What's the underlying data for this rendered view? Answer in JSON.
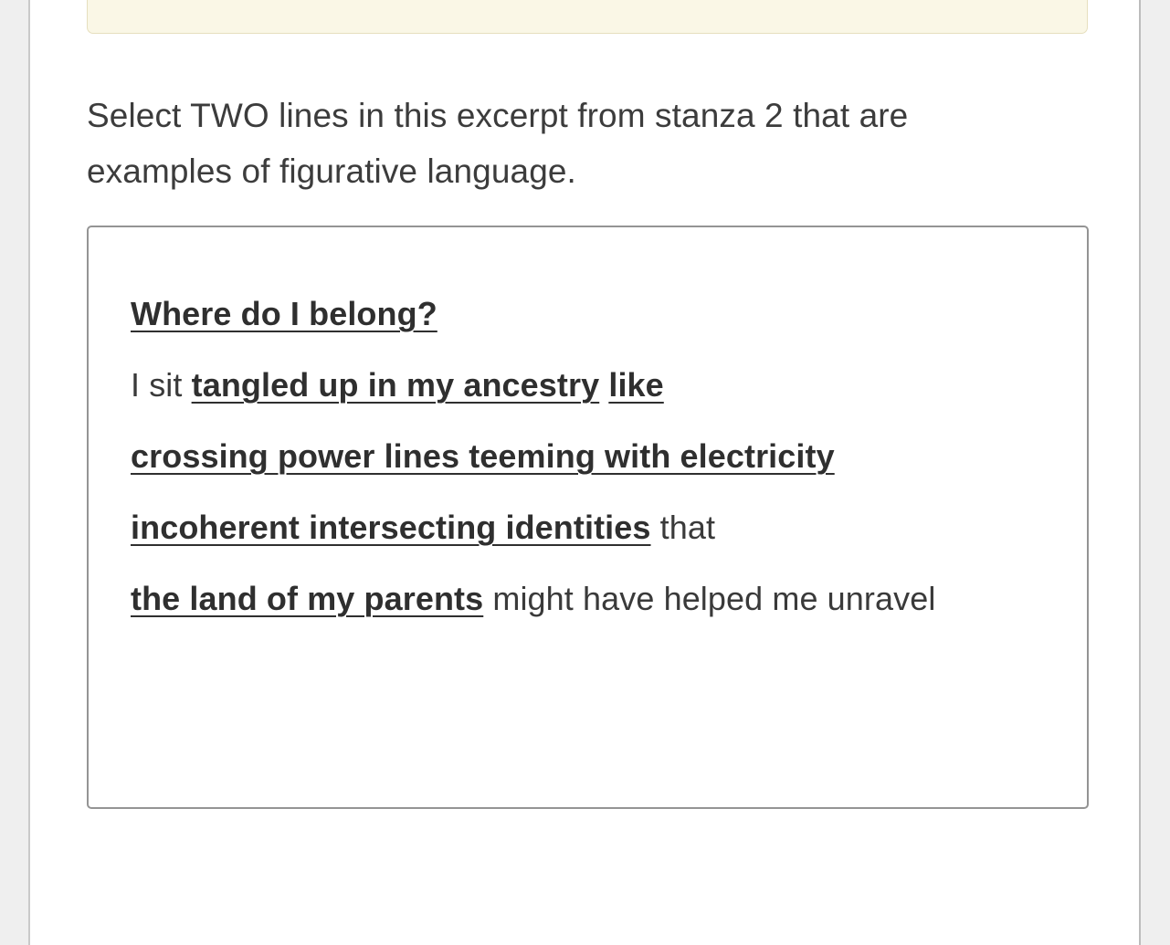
{
  "question": {
    "prompt": "Select TWO lines in this excerpt from stanza 2 that are examples of figurative language."
  },
  "excerpt": {
    "segments": [
      {
        "text": "Where do I belong?",
        "selectable": true
      },
      {
        "text": "I sit ",
        "selectable": false
      },
      {
        "text": "tangled up in my ancestry",
        "selectable": true
      },
      {
        "text": "like",
        "selectable": true
      },
      {
        "text": "crossing power lines teeming with electricity",
        "selectable": true
      },
      {
        "text": "incoherent intersecting identities",
        "selectable": true
      },
      {
        "text": "that",
        "selectable": false
      },
      {
        "text": "the land of my parents",
        "selectable": true
      },
      {
        "text": "might have helped me unravel",
        "selectable": false
      }
    ],
    "lines": [
      {
        "id": "line-1",
        "parts": [
          {
            "text": "Where do I belong?",
            "selectable": true
          }
        ]
      },
      {
        "id": "line-2",
        "parts": [
          {
            "text": "I sit ",
            "selectable": false
          },
          {
            "text": "tangled up in my ancestry",
            "selectable": true
          },
          {
            "text": " ",
            "selectable": false
          },
          {
            "text": "like",
            "selectable": true
          }
        ]
      },
      {
        "id": "line-3",
        "parts": [
          {
            "text": "crossing power lines teeming with electricity",
            "selectable": true
          }
        ]
      },
      {
        "id": "line-4",
        "parts": [
          {
            "text": "incoherent intersecting identities",
            "selectable": true
          },
          {
            "text": " that",
            "selectable": false
          }
        ]
      },
      {
        "id": "line-5",
        "parts": [
          {
            "text": "the land of my parents",
            "selectable": true
          },
          {
            "text": " might have helped me unravel",
            "selectable": false
          }
        ]
      }
    ]
  },
  "colors": {
    "page_background": "#efefef",
    "content_background": "#ffffff",
    "banner_background": "#faf7e6",
    "banner_border": "#e6dfbe",
    "box_border": "#949494",
    "text": "#3a3a3a",
    "selectable_text": "#2f2f2f",
    "gutter_border": "#c9c9c9"
  }
}
